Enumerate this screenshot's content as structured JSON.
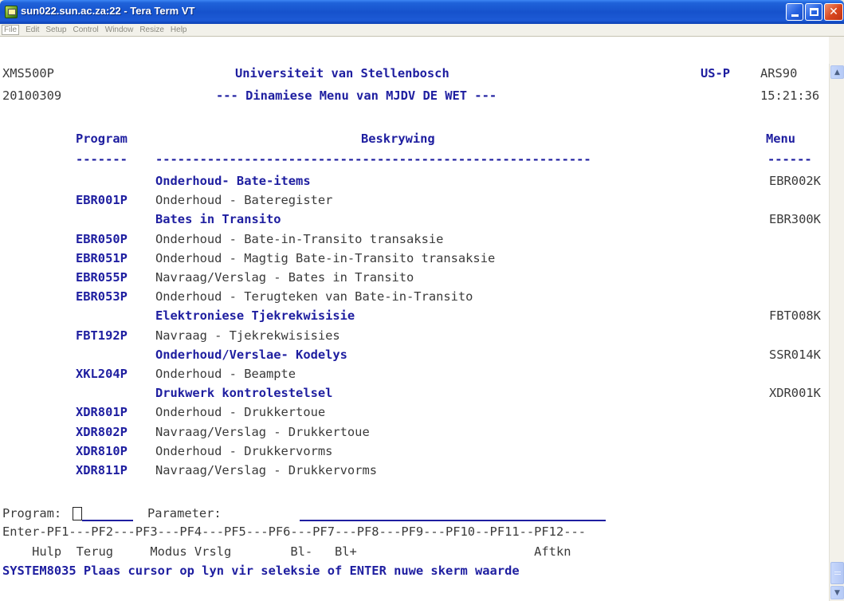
{
  "window": {
    "title": "sun022.sun.ac.za:22 - Tera Term VT",
    "icon": "tera-term-icon"
  },
  "menubar": {
    "items": [
      "File",
      "Edit",
      "Setup",
      "Control",
      "Window",
      "Resize",
      "Help"
    ]
  },
  "header": {
    "screen_id": "XMS500P",
    "date": "20100309",
    "org": "Universiteit van Stellenbosch",
    "subtitle": "--- Dinamiese Menu van MJDV DE WET ---",
    "system": "US-P",
    "code": "ARS90",
    "time": "15:21:36"
  },
  "columns": {
    "program": "Program",
    "description": "Beskrywing",
    "menu": "Menu",
    "rule_program": "-------",
    "rule_description": "-----------------------------------------------------------",
    "rule_menu": "------"
  },
  "rows": [
    {
      "program": "",
      "description": "Onderhoud- Bate-items",
      "menu": "EBR002K",
      "group": true
    },
    {
      "program": "EBR001P",
      "description": "Onderhoud - Bateregister",
      "menu": "",
      "group": false
    },
    {
      "program": "",
      "description": "Bates in Transito",
      "menu": "EBR300K",
      "group": true
    },
    {
      "program": "EBR050P",
      "description": "Onderhoud - Bate-in-Transito transaksie",
      "menu": "",
      "group": false
    },
    {
      "program": "EBR051P",
      "description": "Onderhoud - Magtig Bate-in-Transito transaksie",
      "menu": "",
      "group": false
    },
    {
      "program": "EBR055P",
      "description": "Navraag/Verslag - Bates in Transito",
      "menu": "",
      "group": false
    },
    {
      "program": "EBR053P",
      "description": "Onderhoud - Terugteken van Bate-in-Transito",
      "menu": "",
      "group": false
    },
    {
      "program": "",
      "description": "Elektroniese Tjekrekwisisie",
      "menu": "FBT008K",
      "group": true
    },
    {
      "program": "FBT192P",
      "description": "Navraag - Tjekrekwisisies",
      "menu": "",
      "group": false
    },
    {
      "program": "",
      "description": "Onderhoud/Verslae- Kodelys",
      "menu": "SSR014K",
      "group": true
    },
    {
      "program": "XKL204P",
      "description": "Onderhoud - Beampte",
      "menu": "",
      "group": false
    },
    {
      "program": "",
      "description": "Drukwerk kontrolestelsel",
      "menu": "XDR001K",
      "group": true
    },
    {
      "program": "XDR801P",
      "description": "Onderhoud - Drukkertoue",
      "menu": "",
      "group": false
    },
    {
      "program": "XDR802P",
      "description": "Navraag/Verslag - Drukkertoue",
      "menu": "",
      "group": false
    },
    {
      "program": "XDR810P",
      "description": "Onderhoud - Drukkervorms",
      "menu": "",
      "group": false
    },
    {
      "program": "XDR811P",
      "description": "Navraag/Verslag - Drukkervorms",
      "menu": "",
      "group": false
    }
  ],
  "input": {
    "program_label": "Program:",
    "program_value": "",
    "parameter_label": "Parameter:",
    "parameter_value": ""
  },
  "function_keys": {
    "line": "Enter-PF1---PF2---PF3---PF4---PF5---PF6---PF7---PF8---PF9---PF10--PF11--PF12---",
    "labels": "    Hulp  Terug     Modus Vrslg        Bl-   Bl+                        Aftkn"
  },
  "status": "SYSTEM8035 Plaas cursor op lyn vir seleksie of ENTER nuwe skerm waarde",
  "colors": {
    "titlebar": "#1652cc",
    "terminal_bg": "#ffffff",
    "highlight_text": "#1e1ea0",
    "normal_text": "#3a3a3a"
  }
}
